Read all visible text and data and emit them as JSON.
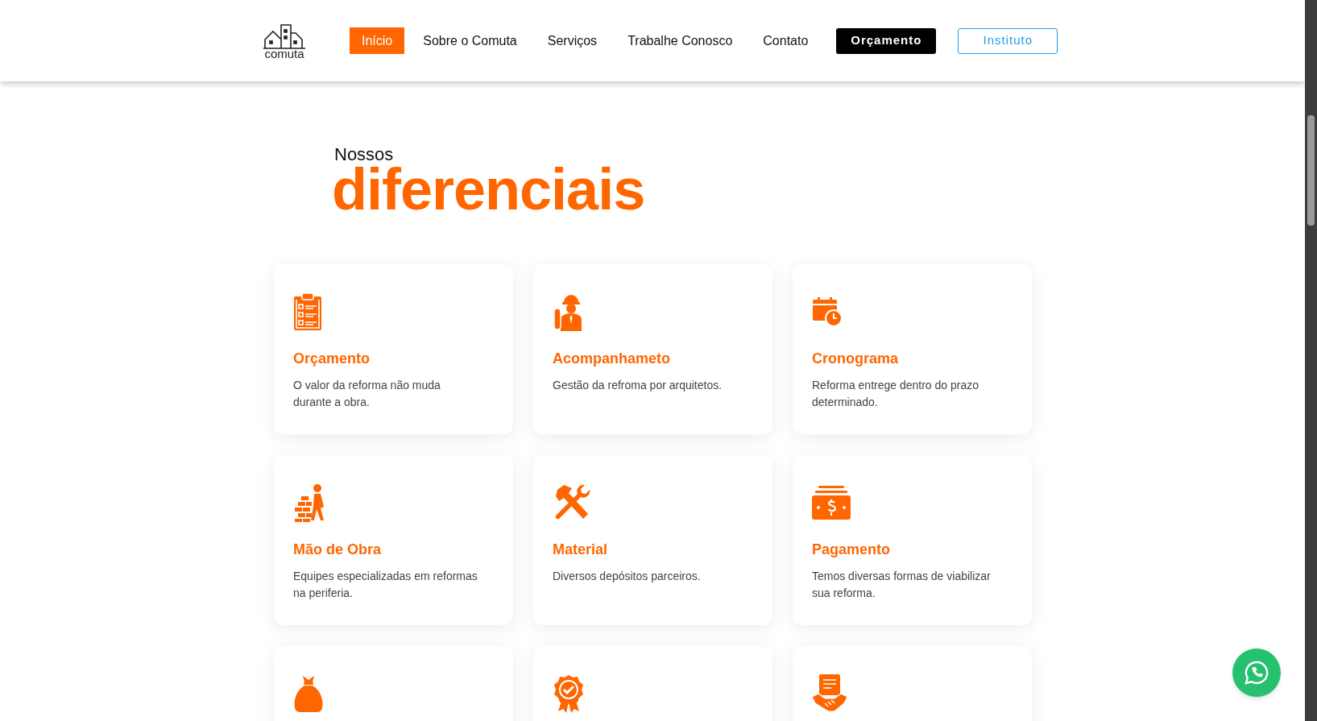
{
  "header": {
    "logo_text": "comuta",
    "nav": [
      {
        "label": "Início",
        "selected": true
      },
      {
        "label": "Sobre o Comuta",
        "selected": false
      },
      {
        "label": "Serviços",
        "selected": false
      },
      {
        "label": "Trabalhe Conosco",
        "selected": false
      },
      {
        "label": "Contato",
        "selected": false
      }
    ],
    "cta_buttons": [
      {
        "label": "Orçamento",
        "kind": "solid"
      },
      {
        "label": "Instituto",
        "kind": "outline"
      }
    ]
  },
  "section": {
    "eyebrow": "Nossos",
    "title": "diferenciais"
  },
  "cards": [
    {
      "kind": "full",
      "title": "Orçamento",
      "text": "O valor da reforma não muda durante a obra."
    },
    {
      "kind": "full",
      "title": "Acompanhameto",
      "text": "Gestão da refroma por arquitetos."
    },
    {
      "kind": "full",
      "title": "Cronograma",
      "text": "Reforma entrege dentro do prazo determinado."
    },
    {
      "kind": "full",
      "title": "Mão de Obra",
      "text": "Equipes especializadas em reformas na periferia."
    },
    {
      "kind": "full",
      "title": "Material",
      "text": "Diversos depósitos parceiros."
    },
    {
      "kind": "full",
      "title": "Pagamento",
      "text": "Temos diversas formas de viabilizar sua reforma."
    },
    {
      "kind": "cut"
    },
    {
      "kind": "cut"
    },
    {
      "kind": "cut"
    }
  ]
}
